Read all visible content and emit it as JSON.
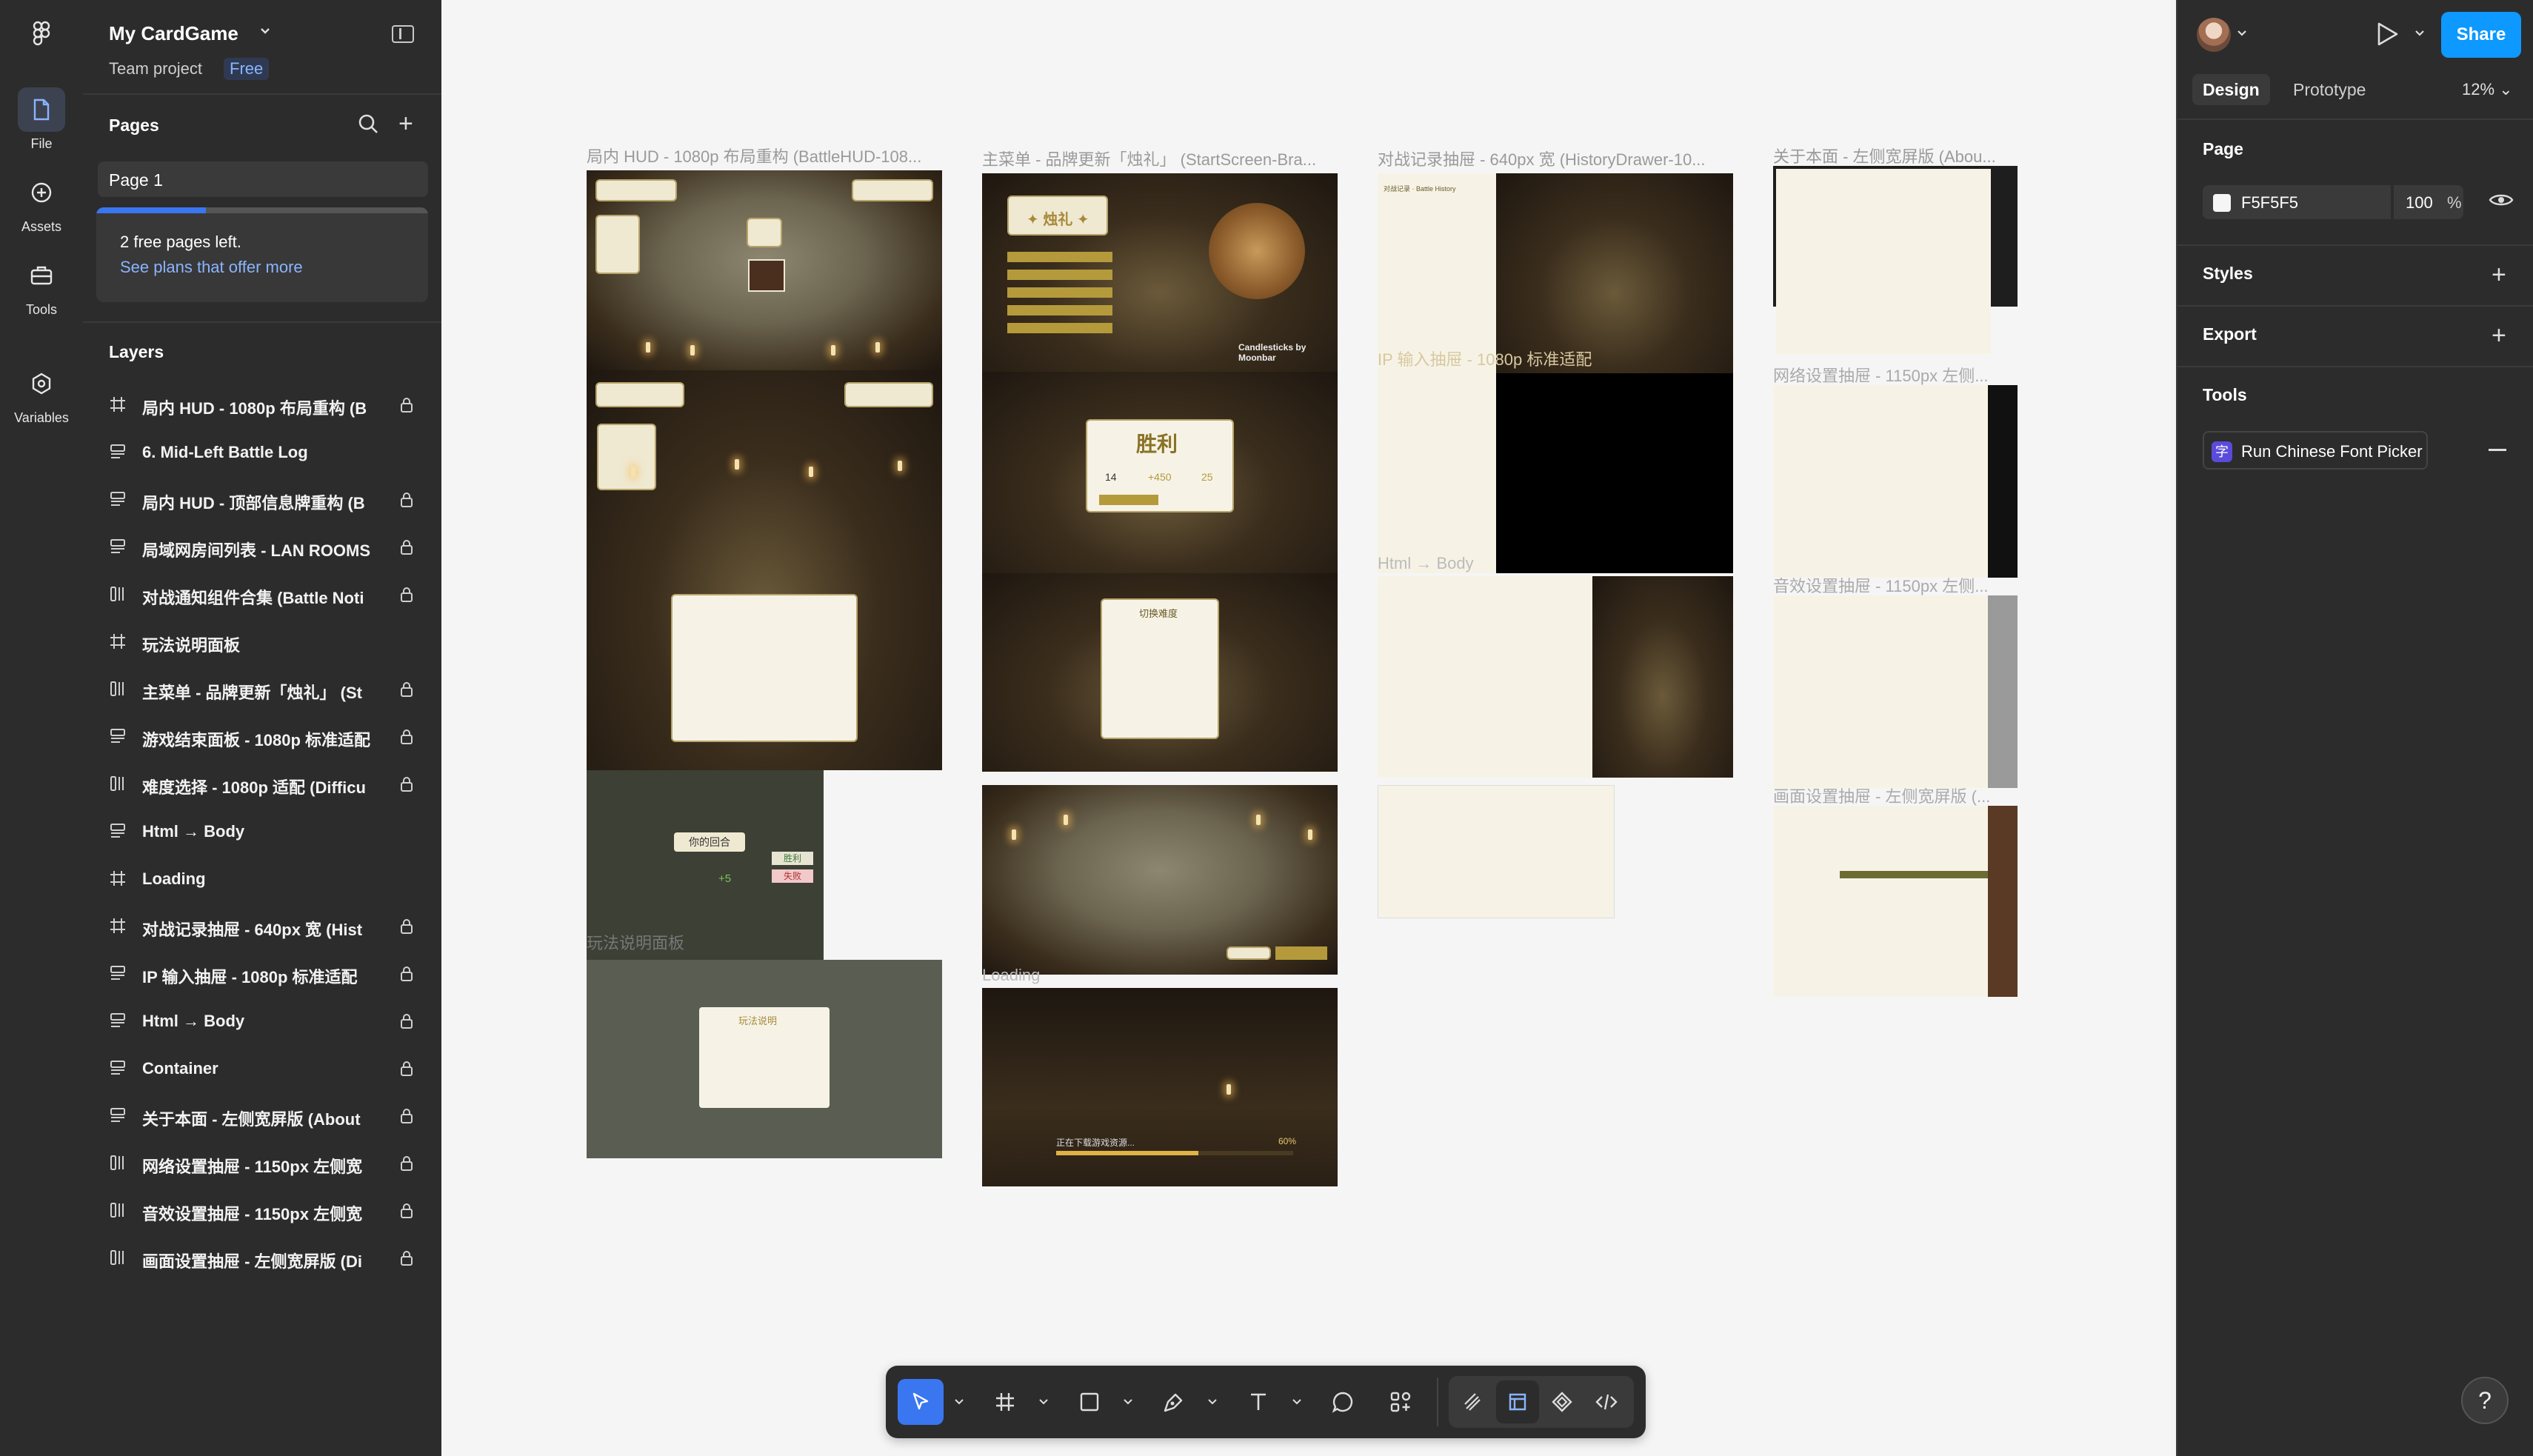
{
  "app": {
    "project_title": "My CardGame",
    "project_subtitle": "Team project",
    "plan_badge": "Free"
  },
  "rail": [
    {
      "label": "File",
      "icon": "file-icon"
    },
    {
      "label": "Assets",
      "icon": "assets-icon"
    },
    {
      "label": "Tools",
      "icon": "tools-icon"
    },
    {
      "label": "Variables",
      "icon": "variables-icon"
    }
  ],
  "pages": {
    "title": "Pages",
    "items": [
      "Page 1"
    ],
    "notice_line1": "2 free pages left.",
    "notice_link": "See plans that offer more",
    "notice_progress": 0.33
  },
  "layers": {
    "title": "Layers",
    "items": [
      {
        "name": "局内 HUD - 1080p 布局重构 (B",
        "icon": "frame-icon"
      },
      {
        "name": "6. Mid-Left Battle Log",
        "icon": "section-icon"
      },
      {
        "name": "局内 HUD - 顶部信息牌重构 (B",
        "icon": "section-icon"
      },
      {
        "name": "局域网房间列表 - LAN ROOMS",
        "icon": "section-icon"
      },
      {
        "name": "对战通知组件合集 (Battle Noti",
        "icon": "autolayout-icon"
      },
      {
        "name": "玩法说明面板",
        "icon": "frame-icon"
      },
      {
        "name": "主菜单 - 品牌更新「烛礼」 (St",
        "icon": "autolayout-icon"
      },
      {
        "name": "游戏结束面板 - 1080p 标准适配",
        "icon": "section-icon"
      },
      {
        "name": "难度选择 - 1080p 适配 (Difficu",
        "icon": "autolayout-icon"
      },
      {
        "name": "Html → Body",
        "icon": "section-icon"
      },
      {
        "name": "Loading",
        "icon": "frame-icon"
      },
      {
        "name": "对战记录抽屉 - 640px 宽 (Hist",
        "icon": "frame-icon"
      },
      {
        "name": "IP 输入抽屉 - 1080p 标准适配",
        "icon": "section-icon"
      },
      {
        "name": "Html → Body",
        "icon": "section-icon"
      },
      {
        "name": "Container",
        "icon": "section-icon"
      },
      {
        "name": "关于本面 - 左侧宽屏版 (About",
        "icon": "section-icon"
      },
      {
        "name": "网络设置抽屉 - 1150px 左侧宽",
        "icon": "autolayout-icon"
      },
      {
        "name": "音效设置抽屉 - 1150px 左侧宽",
        "icon": "autolayout-icon"
      },
      {
        "name": "画面设置抽屉 - 左侧宽屏版 (Di",
        "icon": "autolayout-icon"
      }
    ]
  },
  "canvas": {
    "frame_labels": [
      "局内 HUD - 1080p 布局重构 (BattleHUD-108...",
      "主菜单 - 品牌更新「烛礼」 (StartScreen-Bra...",
      "对战记录抽屉 - 640px 宽 (HistoryDrawer-10...",
      "关于本面 - 左侧宽屏版 (Abou...",
      "网络设置抽屉 - 1150px 左侧...",
      "音效设置抽屉 - 1150px 左侧...",
      "画面设置抽屉 - 左侧宽屏版 (...",
      "IP 输入抽屉 - 1080p 标准适配",
      "Html → Body",
      "玩法说明面板",
      "Loading"
    ],
    "thumb_texts": {
      "menu_logo": "✦ 烛礼 ✦",
      "victory": "胜利",
      "victory_stats": [
        "14",
        "+450",
        "25"
      ],
      "turn_banner": "你的回合",
      "turn_delta": "+5",
      "win_tag": "胜利",
      "lose_tag": "失败",
      "difficulty_title": "切换难度",
      "rules_title": "玩法说明",
      "brand": "Candlesticks by Moonbar",
      "history_title": "对战记录 · Battle History",
      "loading_text": "正在下载游戏资源...",
      "loading_percent": "60%"
    }
  },
  "right": {
    "share_label": "Share",
    "tabs": [
      "Design",
      "Prototype"
    ],
    "zoom": "12%",
    "page_section": "Page",
    "page_color": "F5F5F5",
    "page_opacity": "100",
    "opacity_unit": "%",
    "styles_title": "Styles",
    "export_title": "Export",
    "tools_title": "Tools",
    "plugin_name": "Run Chinese Font Picker",
    "plugin_glyph": "字",
    "help": "?"
  },
  "colors": {
    "accent": "#0d99ff",
    "ui_dark": "#2c2c2c",
    "canvas": "#F5F5F5",
    "gold": "#b59a3c"
  }
}
